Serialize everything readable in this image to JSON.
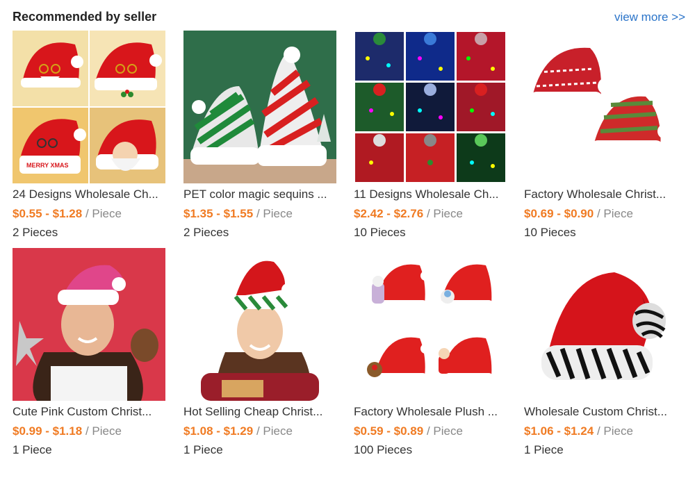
{
  "header": {
    "title": "Recommended by seller",
    "view_more": "view more >>"
  },
  "products": [
    {
      "title": "24 Designs Wholesale Ch...",
      "price": "$0.55 - $1.28",
      "unit": "/ Piece",
      "moq": "2 Pieces",
      "image_icon": "santa-hat-collage"
    },
    {
      "title": "PET color magic sequins ...",
      "price": "$1.35 - $1.55",
      "unit": "/ Piece",
      "moq": "2 Pieces",
      "image_icon": "sequin-hats"
    },
    {
      "title": "11 Designs Wholesale Ch...",
      "price": "$2.42 - $2.76",
      "unit": "/ Piece",
      "moq": "10 Pieces",
      "image_icon": "led-beanies-grid"
    },
    {
      "title": "Factory Wholesale Christ...",
      "price": "$0.69 - $0.90",
      "unit": "/ Piece",
      "moq": "10 Pieces",
      "image_icon": "knit-hats"
    },
    {
      "title": "Cute Pink Custom Christ...",
      "price": "$0.99 - $1.18",
      "unit": "/ Piece",
      "moq": "1 Piece",
      "image_icon": "pink-hat-model"
    },
    {
      "title": "Hot Selling Cheap Christ...",
      "price": "$1.08 - $1.29",
      "unit": "/ Piece",
      "moq": "1 Piece",
      "image_icon": "striped-hat-model"
    },
    {
      "title": "Factory Wholesale Plush ...",
      "price": "$0.59 - $0.89",
      "unit": "/ Piece",
      "moq": "100 Pieces",
      "image_icon": "plush-hats-set"
    },
    {
      "title": "Wholesale Custom Christ...",
      "price": "$1.06 - $1.24",
      "unit": "/ Piece",
      "moq": "1 Piece",
      "image_icon": "zebra-trim-hat"
    }
  ],
  "colors": {
    "price": "#f07b23",
    "link": "#2b74c9"
  }
}
